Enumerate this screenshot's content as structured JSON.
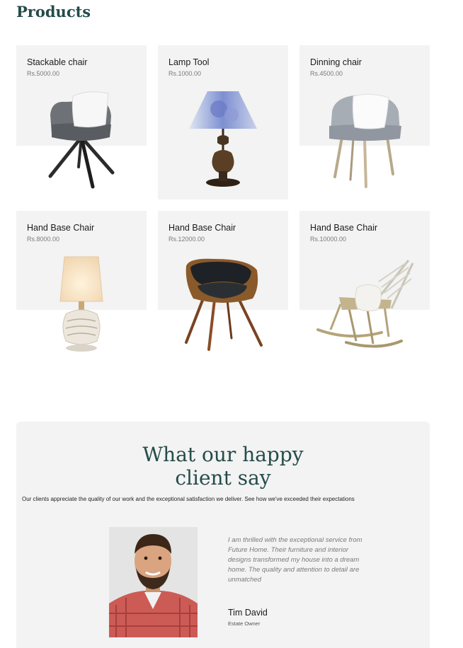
{
  "section_title": "Products",
  "products": [
    {
      "name": "Stackable chair",
      "price": "Rs.5000.00",
      "icon": "office-chair-icon"
    },
    {
      "name": "Lamp Tool",
      "price": "Rs.1000.00",
      "icon": "table-lamp-icon"
    },
    {
      "name": "Dinning chair",
      "price": "Rs.4500.00",
      "icon": "dining-chair-icon"
    },
    {
      "name": "Hand Base Chair",
      "price": "Rs.8000.00",
      "icon": "ceramic-lamp-icon"
    },
    {
      "name": "Hand Base Chair",
      "price": "Rs.12000.00",
      "icon": "leather-chair-icon"
    },
    {
      "name": "Hand Base Chair",
      "price": "Rs.10000.00",
      "icon": "rocking-chair-icon"
    }
  ],
  "testimonial": {
    "title_line1": "What our happy",
    "title_line2": "client say",
    "subtitle": "Our clients appreciate the quality of our work and the exceptional satisfaction we deliver. See how we've exceeded their expectations",
    "quote": "I am thrilled with the exceptional service from Future Home. Their furniture and interior designs transformed my house into a dream home. The quality and attention to detail are unmatched",
    "client_name": "Tim David",
    "client_role": "Estate Owner"
  },
  "colors": {
    "heading": "#254c4b",
    "card_bg": "#f2f3f2"
  }
}
